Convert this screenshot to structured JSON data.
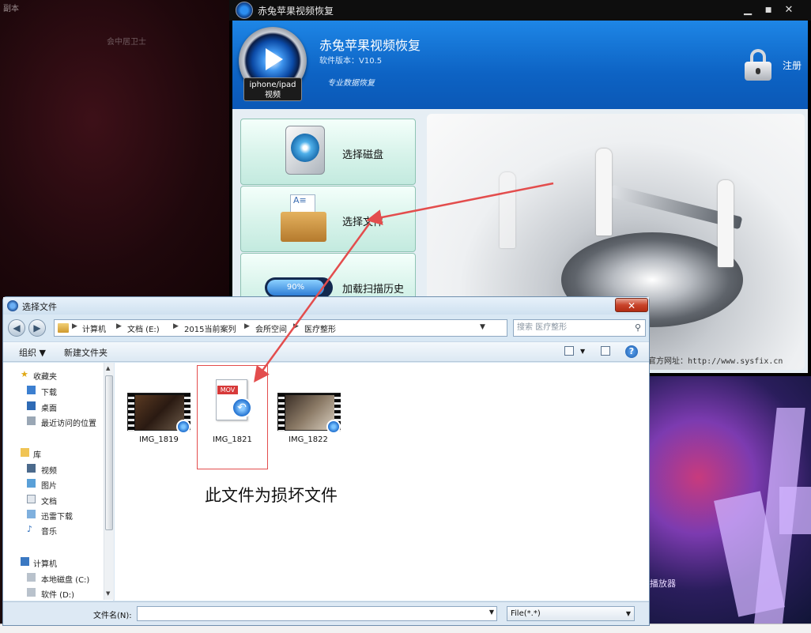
{
  "desktop": {
    "label_top_left": "副本",
    "label_top_left_2": "会中居卫士",
    "label_bottom_right": "迅雷看看播放器",
    "label_right_partial": "播放器"
  },
  "app": {
    "window_title": "赤兔苹果视频恢复",
    "name": "赤兔苹果视频恢复",
    "version": "软件版本：V10.5",
    "slogan": "专业数据恢复",
    "logo_line1": "iphone/ipad",
    "logo_line2": "视频",
    "register_label": "注册",
    "minimize_label": "▁",
    "maximize_label": "■",
    "close_label": "✕",
    "menu": {
      "select_disk": "选择磁盘",
      "select_file": "选择文件",
      "load_history": "加载扫描历史",
      "history_progress": 0.9,
      "history_progress_label": "90%"
    },
    "site_url": "官方网址：http://www.sysfix.cn"
  },
  "dialog": {
    "title": "选择文件",
    "close_label": "✕",
    "breadcrumb": [
      "计算机",
      "文档 (E:)",
      "2015当前案列",
      "会所空间",
      "医疗整形"
    ],
    "search_placeholder": "搜索 医疗整形",
    "organize_label": "组织 ▼",
    "new_folder_label": "新建文件夹",
    "help_label": "?",
    "nav": {
      "favorites": "收藏夹",
      "favorites_items": [
        "下载",
        "桌面",
        "最近访问的位置"
      ],
      "libraries": "库",
      "library_items": [
        "视频",
        "图片",
        "文档",
        "迅雷下载",
        "音乐"
      ],
      "computer": "计算机",
      "computer_items": [
        "本地磁盘 (C:)",
        "软件 (D:)"
      ]
    },
    "files": [
      {
        "name": "IMG_1819",
        "kind": "video"
      },
      {
        "name": "IMG_1821",
        "kind": "mov",
        "tag": "MOV"
      },
      {
        "name": "IMG_1822",
        "kind": "video"
      }
    ],
    "annotation": "此文件为损坏文件",
    "filename_label": "文件名(N):",
    "filename_value": "",
    "filetype_value": "File(*.*)"
  },
  "colors": {
    "app_header_blue": "#0d63c4",
    "menu_button_teal": "#d7f3ea",
    "annotation_red": "#e34d4d",
    "dialog_chrome": "#d9e8f4"
  }
}
